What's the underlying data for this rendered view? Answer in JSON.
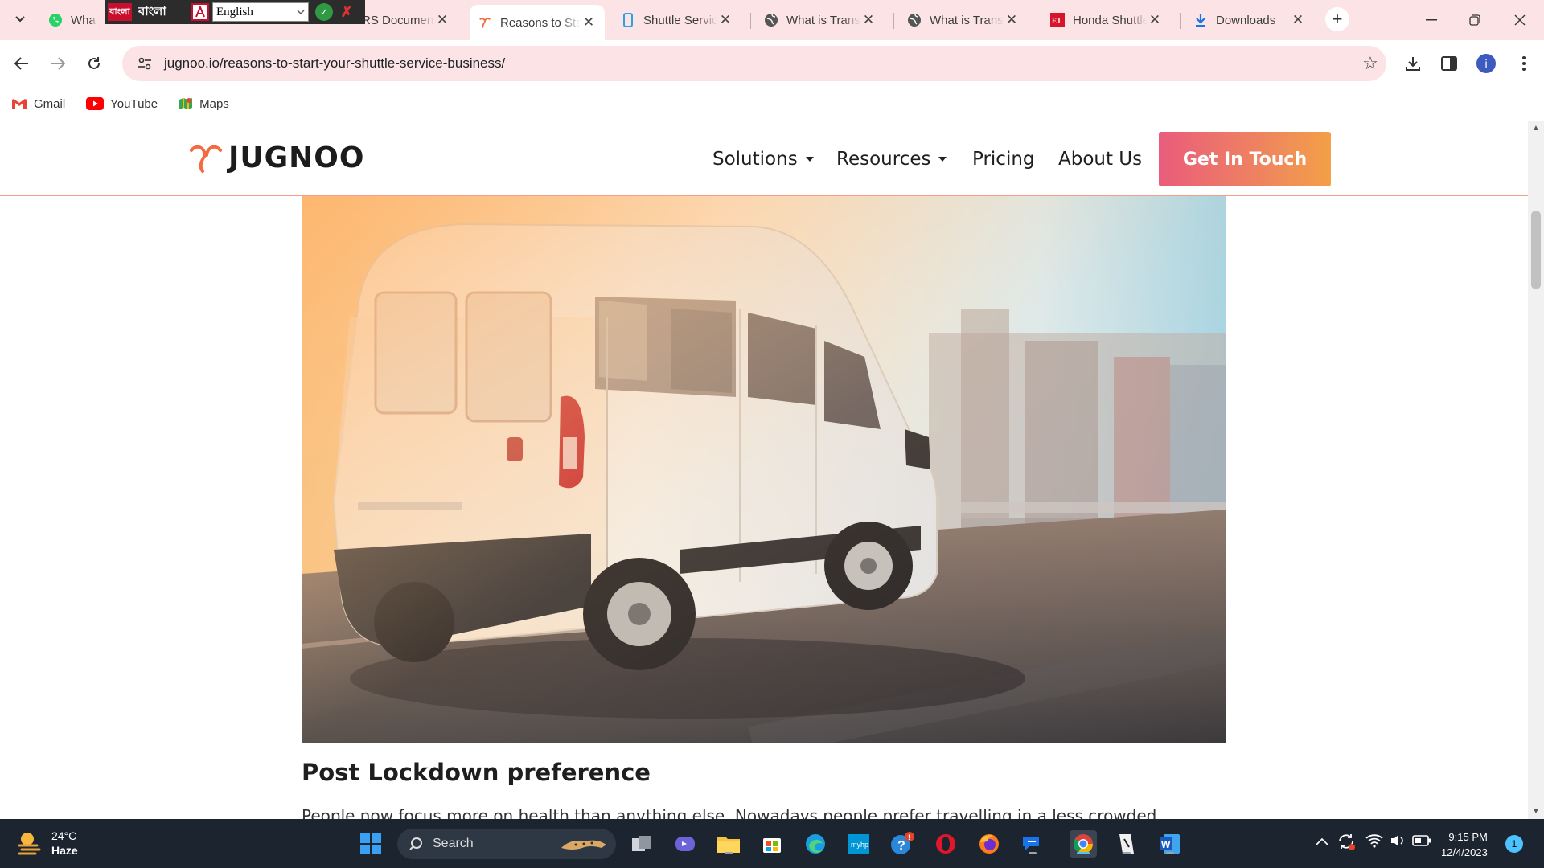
{
  "browser": {
    "tabs": [
      {
        "title": "WhatsApp",
        "favicon": "whatsapp-icon"
      },
      {
        "title": "RS Document",
        "favicon": "document-icon"
      },
      {
        "title": "Reasons to Start your Shuttle Service Business",
        "favicon": "jugnoo-icon",
        "active": true
      },
      {
        "title": "Shuttle Service",
        "favicon": "phone-icon"
      },
      {
        "title": "What is Transport",
        "favicon": "globe-icon"
      },
      {
        "title": "What is Transport",
        "favicon": "globe-icon"
      },
      {
        "title": "Honda Shuttle",
        "favicon": "et-icon"
      },
      {
        "title": "Downloads",
        "favicon": "download-icon"
      }
    ],
    "url": "jugnoo.io/reasons-to-start-your-shuttle-service-business/",
    "profile_initial": "i",
    "bookmarks": [
      {
        "label": "Gmail",
        "icon": "gmail-icon"
      },
      {
        "label": "YouTube",
        "icon": "youtube-icon"
      },
      {
        "label": "Maps",
        "icon": "maps-icon"
      }
    ]
  },
  "ime_toolbar": {
    "brand": "বাংলা",
    "script_label": "বাংলা",
    "language": "English"
  },
  "site": {
    "logo_text": "JUGNOO",
    "nav": {
      "solutions": "Solutions",
      "resources": "Resources",
      "pricing": "Pricing",
      "about": "About Us"
    },
    "cta": "Get In Touch",
    "accent_color": "#f36b3f",
    "cta_gradient": [
      "#ea5c7b",
      "#f3a047"
    ]
  },
  "article": {
    "section_heading": "Post Lockdown preference",
    "paragraph_start": "People now focus more on health than anything else. Nowadays people prefer travelling in a less crowded"
  },
  "taskbar": {
    "weather_temp": "24°C",
    "weather_desc": "Haze",
    "search_placeholder": "Search",
    "time": "9:15 PM",
    "date": "12/4/2023",
    "notification_count": "1"
  }
}
